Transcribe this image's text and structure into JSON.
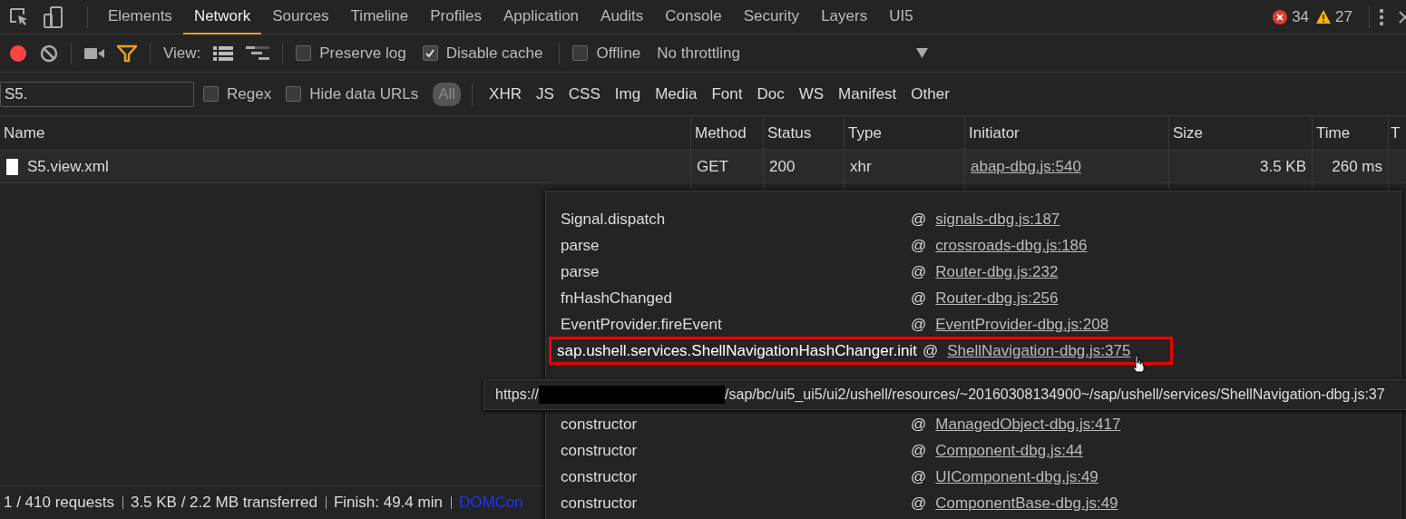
{
  "tabs": [
    {
      "label": "Elements",
      "selected": false
    },
    {
      "label": "Network",
      "selected": true
    },
    {
      "label": "Sources",
      "selected": false
    },
    {
      "label": "Timeline",
      "selected": false
    },
    {
      "label": "Profiles",
      "selected": false
    },
    {
      "label": "Application",
      "selected": false
    },
    {
      "label": "Audits",
      "selected": false
    },
    {
      "label": "Console",
      "selected": false
    },
    {
      "label": "Security",
      "selected": false
    },
    {
      "label": "Layers",
      "selected": false
    },
    {
      "label": "UI5",
      "selected": false
    }
  ],
  "errors": "34",
  "warnings": "27",
  "toolbar": {
    "recording": true,
    "view_label": "View:",
    "checkboxes": [
      {
        "label": "Preserve log",
        "checked": false
      },
      {
        "label": "Disable cache",
        "checked": true
      }
    ],
    "offline": {
      "label": "Offline",
      "checked": false
    },
    "throttling": "No throttling"
  },
  "filter": {
    "value": "S5.",
    "options": [
      {
        "label": "Regex",
        "checked": false
      },
      {
        "label": "Hide data URLs",
        "checked": false
      }
    ],
    "types": [
      {
        "label": "All",
        "selected": true
      },
      {
        "label": "XHR",
        "selected": false
      },
      {
        "label": "JS",
        "selected": false
      },
      {
        "label": "CSS",
        "selected": false
      },
      {
        "label": "Img",
        "selected": false
      },
      {
        "label": "Media",
        "selected": false
      },
      {
        "label": "Font",
        "selected": false
      },
      {
        "label": "Doc",
        "selected": false
      },
      {
        "label": "WS",
        "selected": false
      },
      {
        "label": "Manifest",
        "selected": false
      },
      {
        "label": "Other",
        "selected": false
      }
    ]
  },
  "table": {
    "columns": [
      "Name",
      "Method",
      "Status",
      "Type",
      "Initiator",
      "Size",
      "Time",
      "T"
    ],
    "rows": [
      {
        "name": "S5.view.xml",
        "method": "GET",
        "status": "200",
        "type": "xhr",
        "initiator": "abap-dbg.js:540",
        "size": "3.5 KB",
        "time": "260 ms"
      }
    ]
  },
  "call_stack": {
    "frames_above": [
      {
        "function": "Signal.dispatch",
        "at": "@",
        "source": "signals-dbg.js:187",
        "highlighted": false
      },
      {
        "function": "parse",
        "at": "@",
        "source": "crossroads-dbg.js:186",
        "highlighted": false
      },
      {
        "function": "parse",
        "at": "@",
        "source": "Router-dbg.js:232",
        "highlighted": false
      },
      {
        "function": "fnHashChanged",
        "at": "@",
        "source": "Router-dbg.js:256",
        "highlighted": false
      },
      {
        "function": "EventProvider.fireEvent",
        "at": "@",
        "source": "EventProvider-dbg.js:208",
        "highlighted": false
      },
      {
        "function": "sap.ushell.services.ShellNavigationHashChanger.init",
        "at": "@",
        "source": "ShellNavigation-dbg.js:375",
        "highlighted": true
      }
    ],
    "frames_below": [
      {
        "function": "constructor",
        "at": "@",
        "source": "ManagedObject-dbg.js:417",
        "highlighted": false
      },
      {
        "function": "constructor",
        "at": "@",
        "source": "Component-dbg.js:44",
        "highlighted": false
      },
      {
        "function": "constructor",
        "at": "@",
        "source": "UIComponent-dbg.js:49",
        "highlighted": false
      },
      {
        "function": "constructor",
        "at": "@",
        "source": "ComponentBase-dbg.js:49",
        "highlighted": false
      }
    ]
  },
  "tooltip": {
    "url_start": "https://",
    "url_end": "/sap/bc/ui5_ui5/ui2/ushell/resources/~20160308134900~/sap/ushell/services/ShellNavigation-dbg.js:37"
  },
  "status_bar": [
    "1 / 410 requests",
    "3.5 KB / 2.2 MB transferred",
    "Finish: 49.4 min"
  ],
  "status_link": "DOMCon"
}
